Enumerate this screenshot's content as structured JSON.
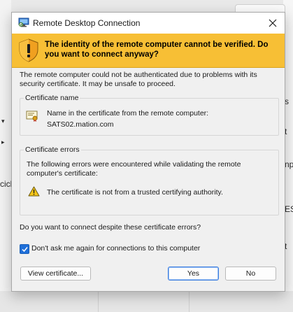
{
  "background": {
    "fragments": [
      "cicle",
      "s",
      "t",
      "np",
      "ES",
      "t"
    ]
  },
  "dialog": {
    "title": "Remote Desktop Connection",
    "warning_banner": "The identity of the remote computer cannot be verified. Do you want to connect anyway?",
    "intro_text": "The remote computer could not be authenticated due to problems with its security certificate. It may be unsafe to proceed.",
    "certificate_name": {
      "group_title": "Certificate name",
      "label": "Name in the certificate from the remote computer:",
      "value": "SATS02.mation.com"
    },
    "certificate_errors": {
      "group_title": "Certificate errors",
      "description": "The following errors were encountered while validating the remote computer's certificate:",
      "errors": [
        "The certificate is not from a trusted certifying authority."
      ]
    },
    "question": "Do you want to connect despite these certificate errors?",
    "dont_ask_checkbox": {
      "label": "Don't ask me again for connections to this computer",
      "checked": true
    },
    "buttons": {
      "view_certificate": "View certificate...",
      "yes": "Yes",
      "no": "No"
    }
  },
  "colors": {
    "banner": "#f7bf35",
    "accent": "#1e6fd9"
  }
}
